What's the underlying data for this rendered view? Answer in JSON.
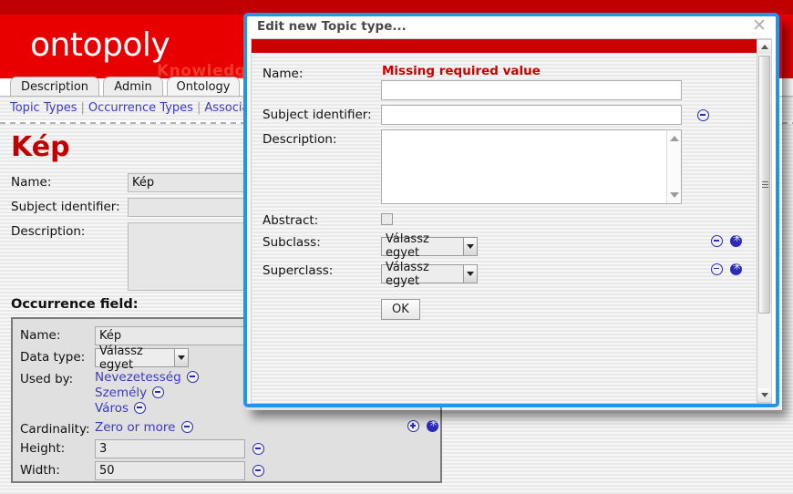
{
  "app": {
    "logo": "ontopoly",
    "watermark": "Knowledge"
  },
  "tabs": [
    {
      "label": "Description",
      "active": false
    },
    {
      "label": "Admin",
      "active": false
    },
    {
      "label": "Ontology",
      "active": true
    },
    {
      "label": "",
      "active": false
    }
  ],
  "subnav": {
    "items": [
      "Topic Types",
      "Occurrence Types",
      "Associat"
    ],
    "separator": "|"
  },
  "page": {
    "title": "Kép",
    "fields": [
      {
        "label": "Name:",
        "value": "Kép",
        "type": "text"
      },
      {
        "label": "Subject identifier:",
        "value": "",
        "type": "text"
      },
      {
        "label": "Description:",
        "value": "",
        "type": "textarea"
      }
    ],
    "occurrence_heading": "Occurrence field:",
    "occurrence": {
      "name_label": "Name:",
      "name_value": "Kép",
      "datatype_label": "Data type:",
      "datatype_value": "Válassz egyet",
      "usedby_label": "Used by:",
      "usedby_items": [
        "Nevezetesség",
        "Személy",
        "Város"
      ],
      "cardinality_label": "Cardinality:",
      "cardinality_value": "Zero or more",
      "height_label": "Height:",
      "height_value": "3",
      "width_label": "Width:",
      "width_value": "50"
    }
  },
  "dialog": {
    "title": "Edit new Topic type...",
    "close_label": "✕",
    "error": "Missing required value",
    "fields": {
      "name_label": "Name:",
      "name_value": "",
      "subject_identifier_label": "Subject identifier:",
      "subject_identifier_value": "",
      "description_label": "Description:",
      "description_value": "",
      "abstract_label": "Abstract:",
      "subclass_label": "Subclass:",
      "subclass_value": "Válassz egyet",
      "superclass_label": "Superclass:",
      "superclass_value": "Válassz egyet"
    },
    "ok_label": "OK"
  },
  "colors": {
    "brand_red": "#e80000",
    "dark_red": "#c00000",
    "dialog_border_blue": "#2196e8",
    "link_blue": "#3b39c8",
    "error_red": "#cc0000"
  }
}
